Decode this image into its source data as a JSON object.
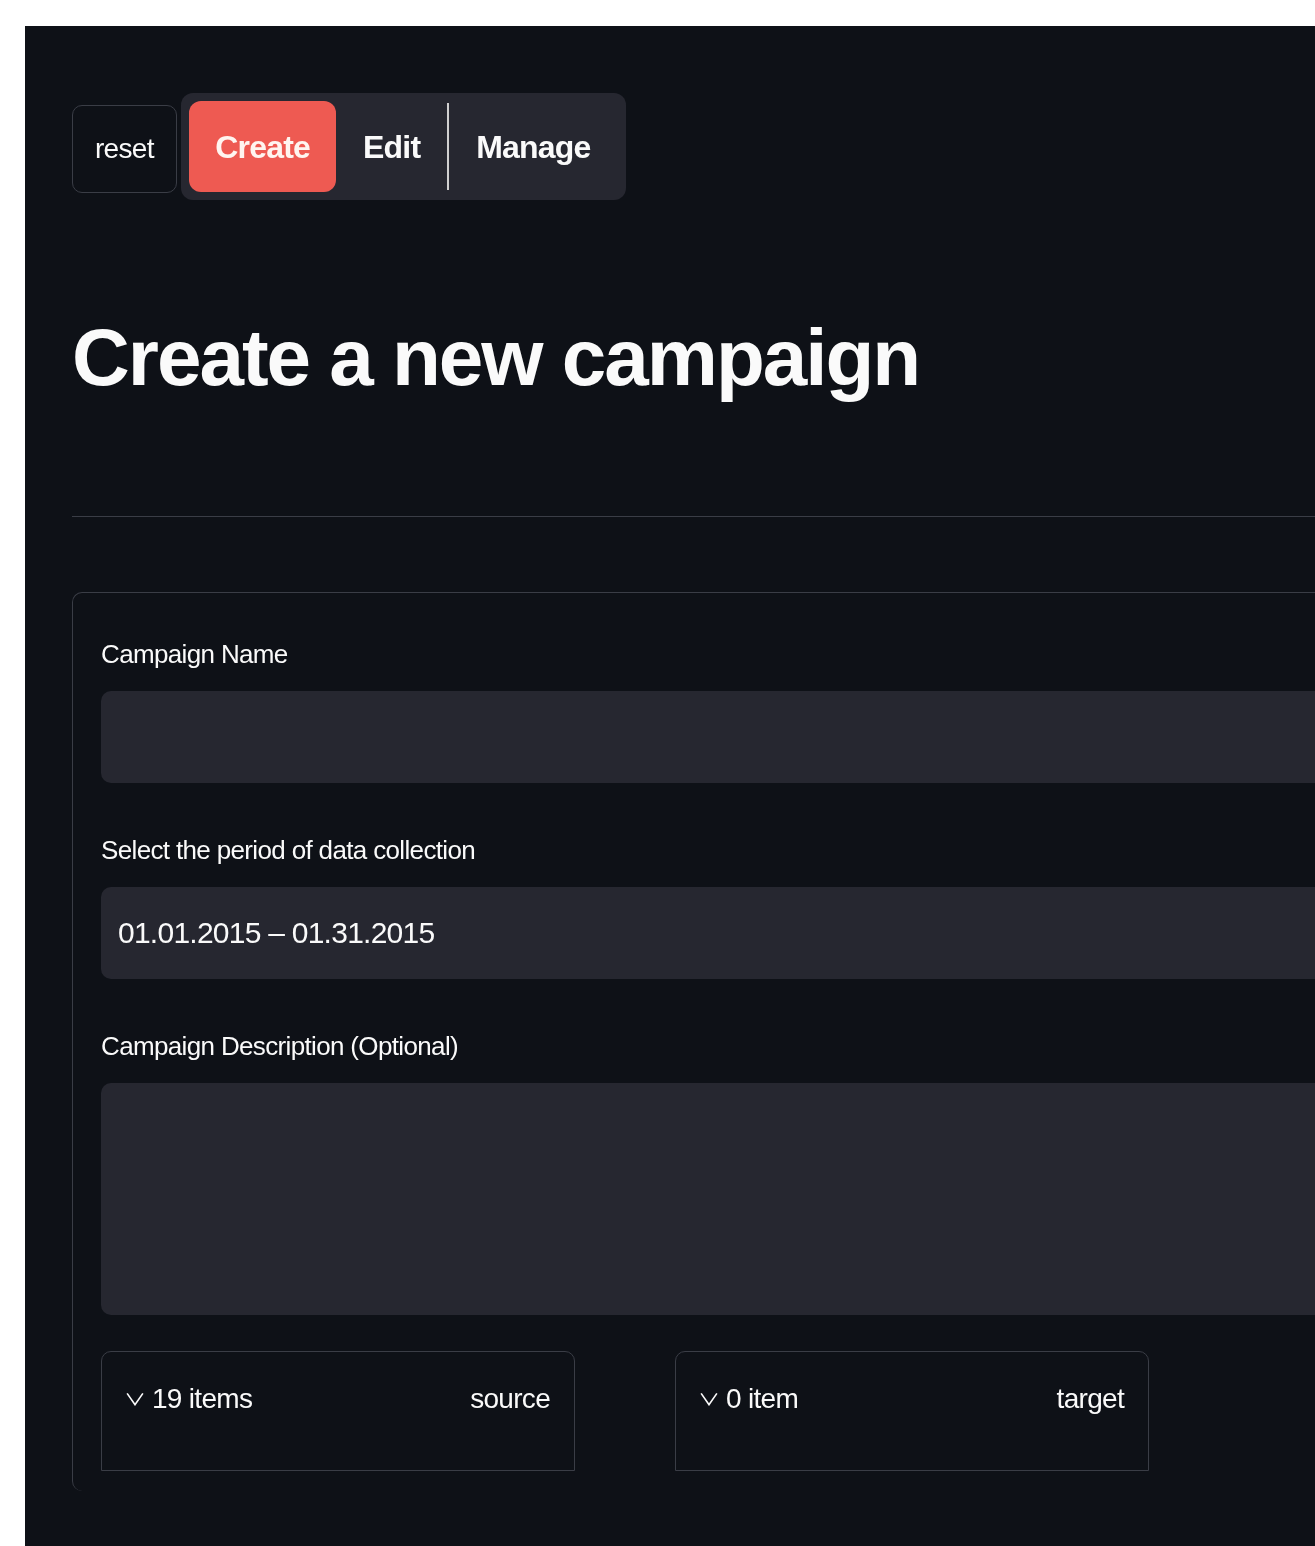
{
  "reset_button": {
    "label": "reset"
  },
  "tabs": [
    {
      "label": "Create",
      "selected": true
    },
    {
      "label": "Edit",
      "selected": false
    },
    {
      "label": "Manage",
      "selected": false
    }
  ],
  "heading": "Create a new campaign",
  "form": {
    "fields": [
      {
        "kind": "text",
        "label": "Campaign Name"
      },
      {
        "kind": "text",
        "label": "Select the period of data collection",
        "value": "01.01.2015 – 01.31.2015"
      },
      {
        "kind": "textarea",
        "label": "Campaign Description (Optional)"
      }
    ],
    "transfer": [
      {
        "count": "19 items",
        "title": "source"
      },
      {
        "count": "0 item",
        "title": "target"
      }
    ]
  }
}
